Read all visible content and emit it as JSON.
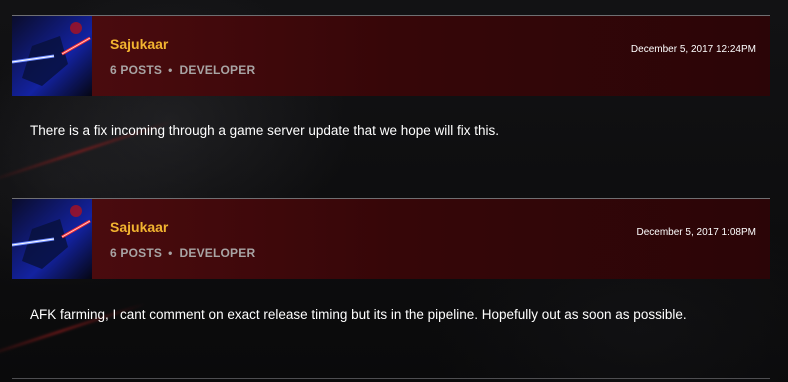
{
  "posts": [
    {
      "author": "Sajukaar",
      "posts_count": "6 POSTS",
      "separator": "•",
      "role": "DEVELOPER",
      "timestamp": "December 5, 2017 12:24PM",
      "body": "There is a fix incoming through a game server update that we hope will fix this."
    },
    {
      "author": "Sajukaar",
      "posts_count": "6 POSTS",
      "separator": "•",
      "role": "DEVELOPER",
      "timestamp": "December 5, 2017 1:08PM",
      "body": "AFK farming, I cant comment on exact release timing but its in the pipeline. Hopefully out as soon as possible."
    }
  ],
  "colors": {
    "author": "#f2b430",
    "header_bar": "#3a070a",
    "meta": "#a8a4a4",
    "body_text": "#ffffff",
    "avatar_blue": "#1a2bb0",
    "avatar_red": "#ff3b3b"
  },
  "icons": {
    "avatar": "lightsaber-avatar-icon"
  }
}
